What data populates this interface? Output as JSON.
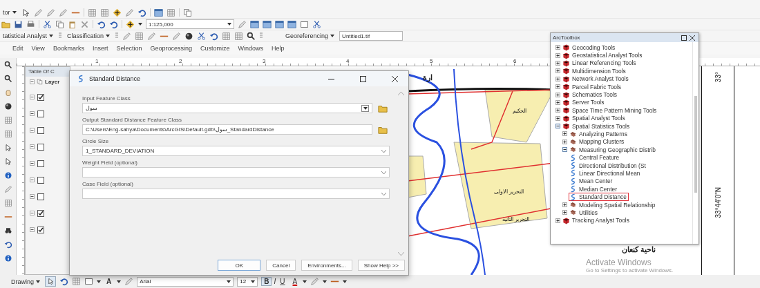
{
  "editor_toolbar": {
    "label": "tor"
  },
  "standard_toolbar": {
    "scale": "1:125,000"
  },
  "analysis_toolbar": {
    "menus": [
      {
        "label": "tatistical Analyst"
      },
      {
        "label": "Classification"
      },
      {
        "label": "Georeferencing"
      }
    ],
    "layer": "Untitled1.tif"
  },
  "menu": [
    "Edit",
    "View",
    "Bookmarks",
    "Insert",
    "Selection",
    "Geoprocessing",
    "Customize",
    "Windows",
    "Help"
  ],
  "ruler": [
    "1",
    "2",
    "3",
    "4",
    "5",
    "6"
  ],
  "toc": {
    "title": "Table Of C",
    "header": "Layer",
    "layers": [
      {
        "checked": true
      },
      {
        "checked": false
      },
      {
        "checked": false
      },
      {
        "checked": false
      },
      {
        "checked": false
      },
      {
        "checked": false
      },
      {
        "checked": false
      },
      {
        "checked": true
      },
      {
        "checked": true
      }
    ]
  },
  "map": {
    "labels": [
      {
        "text": "ارة"
      },
      {
        "text": "الحكيم"
      },
      {
        "text": "التحرير الاولى"
      },
      {
        "text": "التحرير الثانية"
      },
      {
        "text": "ناحية كنعان"
      }
    ],
    "lat_top": "33°",
    "lat": "33°44'0\"N"
  },
  "dialog": {
    "title": "Standard Distance",
    "fields": [
      {
        "kind": "dropdown",
        "label": "Input Feature Class",
        "value": "سول",
        "browse": true
      },
      {
        "kind": "path",
        "label": "Output Standard Distance Feature Class",
        "value": "C:\\Users\\Eng-sahya\\Documents\\ArcGIS\\Default.gdb\\سول_StandardDistance",
        "browse": true
      },
      {
        "kind": "select",
        "label": "Circle Size",
        "value": "1_STANDARD_DEVIATION",
        "browse": false
      },
      {
        "kind": "select",
        "label": "Weight Field (optional)",
        "browse": false
      },
      {
        "kind": "select",
        "label": "Case Field (optional)",
        "browse": false
      }
    ],
    "buttons": [
      "OK",
      "Cancel",
      "Environments...",
      "Show Help >>"
    ]
  },
  "toolbox": {
    "title": "ArcToolbox",
    "items": [
      {
        "kind": "toolbox",
        "label": "Geocoding Tools",
        "expanded": false,
        "selected": false
      },
      {
        "kind": "toolbox",
        "label": "Geostatistical Analyst Tools",
        "expanded": false,
        "selected": false
      },
      {
        "kind": "toolbox",
        "label": "Linear Referencing Tools",
        "expanded": false,
        "selected": false
      },
      {
        "kind": "toolbox",
        "label": "Multidimension Tools",
        "expanded": false,
        "selected": false
      },
      {
        "kind": "toolbox",
        "label": "Network Analyst Tools",
        "expanded": false,
        "selected": false
      },
      {
        "kind": "toolbox",
        "label": "Parcel Fabric Tools",
        "expanded": false,
        "selected": false
      },
      {
        "kind": "toolbox",
        "label": "Schematics Tools",
        "expanded": false,
        "selected": false
      },
      {
        "kind": "toolbox",
        "label": "Server Tools",
        "expanded": false,
        "selected": false
      },
      {
        "kind": "toolbox",
        "label": "Space Time Pattern Mining Tools",
        "expanded": false,
        "selected": false
      },
      {
        "kind": "toolbox",
        "label": "Spatial Analyst Tools",
        "expanded": false,
        "selected": false
      },
      {
        "kind": "toolbox",
        "label": "Spatial Statistics Tools",
        "expanded": true,
        "selected": false,
        "children": [
          {
            "kind": "toolset",
            "label": "Analyzing Patterns",
            "expanded": false,
            "selected": false
          },
          {
            "kind": "toolset",
            "label": "Mapping Clusters",
            "expanded": false,
            "selected": false
          },
          {
            "kind": "toolset",
            "label": "Measuring Geographic Distrib",
            "expanded": true,
            "selected": false,
            "children": [
              {
                "kind": "tool",
                "label": "Central Feature",
                "selected": false
              },
              {
                "kind": "tool",
                "label": "Directional Distribution (St",
                "selected": false
              },
              {
                "kind": "tool",
                "label": "Linear Directional Mean",
                "selected": false
              },
              {
                "kind": "tool",
                "label": "Mean Center",
                "selected": false
              },
              {
                "kind": "tool",
                "label": "Median Center",
                "selected": false
              },
              {
                "kind": "tool",
                "label": "Standard Distance",
                "selected": true
              }
            ]
          },
          {
            "kind": "toolset",
            "label": "Modeling Spatial Relationship",
            "expanded": false,
            "selected": false
          },
          {
            "kind": "toolset",
            "label": "Utilities",
            "expanded": false,
            "selected": false
          }
        ]
      },
      {
        "kind": "toolbox",
        "label": "Tracking Analyst Tools",
        "expanded": false,
        "selected": false
      }
    ]
  },
  "drawing_toolbar": {
    "label": "Drawing",
    "text_tool": "A",
    "font": "Arial",
    "size": "12",
    "styles": [
      "B",
      "I",
      "U"
    ],
    "font_color": "A"
  },
  "activation": {
    "title": "Activate Windows",
    "message": "Go to Settings to activate Windows."
  }
}
